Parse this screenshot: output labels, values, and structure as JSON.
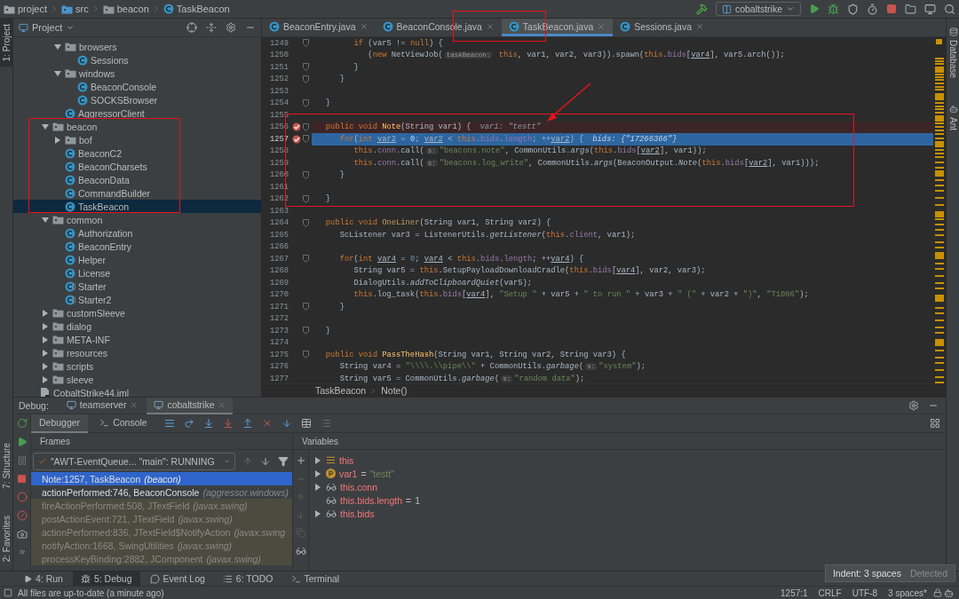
{
  "breadcrumb": [
    {
      "label": "project",
      "kind": "module"
    },
    {
      "label": "src",
      "kind": "source"
    },
    {
      "label": "beacon",
      "kind": "package"
    },
    {
      "label": "TaskBeacon",
      "kind": "class"
    }
  ],
  "run_config": {
    "label": "cobaltstrike"
  },
  "left_strip": {
    "top": [
      {
        "label": "1: Project",
        "selected": true
      }
    ],
    "bottom": [
      {
        "label": "7: Structure",
        "selected": false
      },
      {
        "label": "2: Favorites",
        "selected": false
      }
    ]
  },
  "right_strip": [
    {
      "label": "Database"
    },
    {
      "label": "Ant"
    }
  ],
  "project_panel": {
    "title": "Project",
    "tree": [
      {
        "children": [
          {
            "children": [
              {
                "label": "browsers",
                "kind": "folder",
                "expanded": true,
                "selected": false,
                "children": [
                  {
                    "label": "Sessions",
                    "kind": "class",
                    "selected": false
                  }
                ]
              },
              {
                "label": "windows",
                "kind": "folder",
                "expanded": true,
                "selected": false,
                "children": [
                  {
                    "label": "BeaconConsole",
                    "kind": "class",
                    "selected": false
                  },
                  {
                    "label": "SOCKSBrowser",
                    "kind": "class",
                    "selected": false
                  }
                ]
              },
              {
                "label": "AggressorClient",
                "kind": "class",
                "selected": false
              }
            ]
          },
          {
            "label": "beacon",
            "kind": "folder",
            "expanded": true,
            "selected": false,
            "children": [
              {
                "label": "bof",
                "kind": "folder",
                "expanded": false,
                "selected": false
              },
              {
                "label": "BeaconC2",
                "kind": "class",
                "selected": false
              },
              {
                "label": "BeaconCharsets",
                "kind": "class",
                "selected": false
              },
              {
                "label": "BeaconData",
                "kind": "class",
                "selected": false
              },
              {
                "label": "CommandBuilder",
                "kind": "class",
                "selected": false
              },
              {
                "label": "TaskBeacon",
                "kind": "class",
                "selected": true
              }
            ]
          },
          {
            "label": "common",
            "kind": "folder",
            "expanded": true,
            "selected": false,
            "children": [
              {
                "label": "Authorization",
                "kind": "class",
                "selected": false
              },
              {
                "label": "BeaconEntry",
                "kind": "class",
                "selected": false
              },
              {
                "label": "Helper",
                "kind": "class",
                "selected": false
              },
              {
                "label": "License",
                "kind": "class",
                "selected": false
              },
              {
                "label": "Starter",
                "kind": "runnable",
                "selected": false
              },
              {
                "label": "Starter2",
                "kind": "runnable",
                "selected": false
              }
            ]
          },
          {
            "label": "customSleeve",
            "kind": "folder",
            "expanded": false,
            "selected": false
          },
          {
            "label": "dialog",
            "kind": "folder",
            "expanded": false,
            "selected": false
          },
          {
            "label": "META-INF",
            "kind": "folder",
            "expanded": false,
            "selected": false
          },
          {
            "label": "resources",
            "kind": "folder",
            "expanded": false,
            "selected": false
          },
          {
            "label": "scripts",
            "kind": "folder",
            "expanded": false,
            "selected": false
          },
          {
            "label": "sleeve",
            "kind": "folder",
            "expanded": false,
            "selected": false
          }
        ]
      },
      {
        "label": "CobaltStrike44.iml",
        "kind": "file",
        "selected": false
      }
    ]
  },
  "editor": {
    "tabs": [
      {
        "label": "BeaconEntry.java",
        "selected": false
      },
      {
        "label": "BeaconConsole.java",
        "selected": false
      },
      {
        "label": "TaskBeacon.java",
        "selected": true
      },
      {
        "label": "Sessions.java",
        "selected": false
      }
    ],
    "lines": [
      {
        "number": "1249",
        "fold": true,
        "breakpoint": false,
        "current": false,
        "tokens": [
          {
            "kind": "keyword",
            "text": "         if"
          },
          {
            "kind": "plain",
            "text": " (var5 != "
          },
          {
            "kind": "keyword",
            "text": "null"
          },
          {
            "kind": "plain",
            "text": ") {"
          }
        ]
      },
      {
        "number": "1250",
        "fold": false,
        "breakpoint": false,
        "current": false,
        "tokens": [
          {
            "kind": "plain",
            "text": "            ("
          },
          {
            "kind": "keyword",
            "text": "new"
          },
          {
            "kind": "plain",
            "text": " NetViewJob("
          },
          {
            "kind": "hint",
            "text": "taskBeacon:"
          },
          {
            "kind": "keyword",
            "text": " this"
          },
          {
            "kind": "plain",
            "text": ", var1, var2, var3)).spawn("
          },
          {
            "kind": "keyword",
            "text": "this"
          },
          {
            "kind": "plain",
            "text": "."
          },
          {
            "kind": "field",
            "text": "bids"
          },
          {
            "kind": "plain",
            "text": "["
          },
          {
            "kind": "local",
            "text": "var4"
          },
          {
            "kind": "plain",
            "text": "], var5.arch());"
          }
        ]
      },
      {
        "number": "1251",
        "fold": true,
        "breakpoint": false,
        "current": false,
        "tokens": [
          {
            "kind": "plain",
            "text": "         }"
          }
        ]
      },
      {
        "number": "1252",
        "fold": true,
        "breakpoint": false,
        "current": false,
        "tokens": [
          {
            "kind": "plain",
            "text": "      }"
          }
        ]
      },
      {
        "number": "1253",
        "fold": false,
        "breakpoint": false,
        "current": false
      },
      {
        "number": "1254",
        "fold": true,
        "breakpoint": false,
        "current": false,
        "tokens": [
          {
            "kind": "plain",
            "text": "   }"
          }
        ]
      },
      {
        "number": "1255",
        "fold": false,
        "breakpoint": false,
        "current": false
      },
      {
        "number": "1256",
        "fold": true,
        "breakpoint": true,
        "current": false,
        "tokens": [
          {
            "kind": "keyword",
            "text": "   public void "
          },
          {
            "kind": "method",
            "text": "Note"
          },
          {
            "kind": "plain",
            "text": "(String var1) {"
          },
          {
            "kind": "value",
            "text": "var1: \"testt\""
          }
        ]
      },
      {
        "number": "1257",
        "fold": true,
        "breakpoint": true,
        "current": true,
        "tokens": [
          {
            "kind": "keyword",
            "text": "      for"
          },
          {
            "kind": "plain",
            "text": "("
          },
          {
            "kind": "keyword",
            "text": "int "
          },
          {
            "kind": "local",
            "text": "var2"
          },
          {
            "kind": "plain",
            "text": " = "
          },
          {
            "kind": "number",
            "text": "0"
          },
          {
            "kind": "plain",
            "text": "; "
          },
          {
            "kind": "local",
            "text": "var2"
          },
          {
            "kind": "plain",
            "text": " < "
          },
          {
            "kind": "keyword",
            "text": "this"
          },
          {
            "kind": "plain",
            "text": "."
          },
          {
            "kind": "field",
            "text": "bids"
          },
          {
            "kind": "plain",
            "text": "."
          },
          {
            "kind": "field",
            "text": "length"
          },
          {
            "kind": "plain",
            "text": "; ++"
          },
          {
            "kind": "local",
            "text": "var2"
          },
          {
            "kind": "plain",
            "text": ") {"
          },
          {
            "kind": "value",
            "text": "bids: {\"17266366\"}"
          }
        ]
      },
      {
        "number": "1258",
        "fold": false,
        "breakpoint": false,
        "current": false,
        "tokens": [
          {
            "kind": "keyword",
            "text": "         this"
          },
          {
            "kind": "plain",
            "text": "."
          },
          {
            "kind": "field",
            "text": "conn"
          },
          {
            "kind": "plain",
            "text": ".call("
          },
          {
            "kind": "hint",
            "text": "s:"
          },
          {
            "kind": "string",
            "text": "\"beacons.note\""
          },
          {
            "kind": "plain",
            "text": ", CommonUtils."
          },
          {
            "kind": "static",
            "text": "args"
          },
          {
            "kind": "plain",
            "text": "("
          },
          {
            "kind": "keyword",
            "text": "this"
          },
          {
            "kind": "plain",
            "text": "."
          },
          {
            "kind": "field",
            "text": "bids"
          },
          {
            "kind": "plain",
            "text": "["
          },
          {
            "kind": "local",
            "text": "var2"
          },
          {
            "kind": "plain",
            "text": "], var1));"
          }
        ]
      },
      {
        "number": "1259",
        "fold": false,
        "breakpoint": false,
        "current": false,
        "tokens": [
          {
            "kind": "keyword",
            "text": "         this"
          },
          {
            "kind": "plain",
            "text": "."
          },
          {
            "kind": "field",
            "text": "conn"
          },
          {
            "kind": "plain",
            "text": ".call("
          },
          {
            "kind": "hint",
            "text": "s:"
          },
          {
            "kind": "string",
            "text": "\"beacons.log_write\""
          },
          {
            "kind": "plain",
            "text": ", CommonUtils."
          },
          {
            "kind": "static",
            "text": "args"
          },
          {
            "kind": "plain",
            "text": "(BeaconOutput."
          },
          {
            "kind": "static",
            "text": "Note"
          },
          {
            "kind": "plain",
            "text": "("
          },
          {
            "kind": "keyword",
            "text": "this"
          },
          {
            "kind": "plain",
            "text": "."
          },
          {
            "kind": "field",
            "text": "bids"
          },
          {
            "kind": "plain",
            "text": "["
          },
          {
            "kind": "local",
            "text": "var2"
          },
          {
            "kind": "plain",
            "text": "], var1)));"
          }
        ]
      },
      {
        "number": "1260",
        "fold": true,
        "breakpoint": false,
        "current": false,
        "tokens": [
          {
            "kind": "plain",
            "text": "      }"
          }
        ]
      },
      {
        "number": "1261",
        "fold": false,
        "breakpoint": false,
        "current": false
      },
      {
        "number": "1262",
        "fold": true,
        "breakpoint": false,
        "current": false,
        "tokens": [
          {
            "kind": "plain",
            "text": "   }"
          }
        ]
      },
      {
        "number": "1263",
        "fold": false,
        "breakpoint": false,
        "current": false
      },
      {
        "number": "1264",
        "fold": true,
        "breakpoint": false,
        "current": false,
        "tokens": [
          {
            "kind": "keyword",
            "text": "   public void "
          },
          {
            "kind": "unused",
            "text": "OneLiner"
          },
          {
            "kind": "plain",
            "text": "(String var1, String var2) {"
          }
        ]
      },
      {
        "number": "1265",
        "fold": false,
        "breakpoint": false,
        "current": false,
        "tokens": [
          {
            "kind": "plain",
            "text": "      ScListener var3 = ListenerUtils."
          },
          {
            "kind": "static",
            "text": "getListener"
          },
          {
            "kind": "plain",
            "text": "("
          },
          {
            "kind": "keyword",
            "text": "this"
          },
          {
            "kind": "plain",
            "text": "."
          },
          {
            "kind": "field",
            "text": "client"
          },
          {
            "kind": "plain",
            "text": ", var1);"
          }
        ]
      },
      {
        "number": "1266",
        "fold": false,
        "breakpoint": false,
        "current": false
      },
      {
        "number": "1267",
        "fold": true,
        "breakpoint": false,
        "current": false,
        "tokens": [
          {
            "kind": "keyword",
            "text": "      for"
          },
          {
            "kind": "plain",
            "text": "("
          },
          {
            "kind": "keyword",
            "text": "int "
          },
          {
            "kind": "local",
            "text": "var4"
          },
          {
            "kind": "plain",
            "text": " = "
          },
          {
            "kind": "number",
            "text": "0"
          },
          {
            "kind": "plain",
            "text": "; "
          },
          {
            "kind": "local",
            "text": "var4"
          },
          {
            "kind": "plain",
            "text": " < "
          },
          {
            "kind": "keyword",
            "text": "this"
          },
          {
            "kind": "plain",
            "text": "."
          },
          {
            "kind": "field",
            "text": "bids"
          },
          {
            "kind": "plain",
            "text": "."
          },
          {
            "kind": "field",
            "text": "length"
          },
          {
            "kind": "plain",
            "text": "; ++"
          },
          {
            "kind": "local",
            "text": "var4"
          },
          {
            "kind": "plain",
            "text": ") {"
          }
        ]
      },
      {
        "number": "1268",
        "fold": false,
        "breakpoint": false,
        "current": false,
        "tokens": [
          {
            "kind": "plain",
            "text": "         String var5 = "
          },
          {
            "kind": "keyword",
            "text": "this"
          },
          {
            "kind": "plain",
            "text": ".SetupPayloadDownloadCradle("
          },
          {
            "kind": "keyword",
            "text": "this"
          },
          {
            "kind": "plain",
            "text": "."
          },
          {
            "kind": "field",
            "text": "bids"
          },
          {
            "kind": "plain",
            "text": "["
          },
          {
            "kind": "local",
            "text": "var4"
          },
          {
            "kind": "plain",
            "text": "], var2, var3);"
          }
        ]
      },
      {
        "number": "1269",
        "fold": false,
        "breakpoint": false,
        "current": false,
        "tokens": [
          {
            "kind": "plain",
            "text": "         DialogUtils."
          },
          {
            "kind": "static",
            "text": "addToClipboardQuiet"
          },
          {
            "kind": "plain",
            "text": "(var5);"
          }
        ]
      },
      {
        "number": "1270",
        "fold": false,
        "breakpoint": false,
        "current": false,
        "tokens": [
          {
            "kind": "keyword",
            "text": "         this"
          },
          {
            "kind": "plain",
            "text": ".log_task("
          },
          {
            "kind": "keyword",
            "text": "this"
          },
          {
            "kind": "plain",
            "text": "."
          },
          {
            "kind": "field",
            "text": "bids"
          },
          {
            "kind": "plain",
            "text": "["
          },
          {
            "kind": "local",
            "text": "var4"
          },
          {
            "kind": "plain",
            "text": "], "
          },
          {
            "kind": "string",
            "text": "\"Setup \""
          },
          {
            "kind": "plain",
            "text": " + var5 + "
          },
          {
            "kind": "string",
            "text": "\" to run \""
          },
          {
            "kind": "plain",
            "text": " + var3 + "
          },
          {
            "kind": "string",
            "text": "\" (\""
          },
          {
            "kind": "plain",
            "text": " + var2 + "
          },
          {
            "kind": "string",
            "text": "\")\""
          },
          {
            "kind": "plain",
            "text": ", "
          },
          {
            "kind": "string",
            "text": "\"T1086\""
          },
          {
            "kind": "plain",
            "text": ");"
          }
        ]
      },
      {
        "number": "1271",
        "fold": true,
        "breakpoint": false,
        "current": false,
        "tokens": [
          {
            "kind": "plain",
            "text": "      }"
          }
        ]
      },
      {
        "number": "1272",
        "fold": false,
        "breakpoint": false,
        "current": false
      },
      {
        "number": "1273",
        "fold": true,
        "breakpoint": false,
        "current": false,
        "tokens": [
          {
            "kind": "plain",
            "text": "   }"
          }
        ]
      },
      {
        "number": "1274",
        "fold": false,
        "breakpoint": false,
        "current": false
      },
      {
        "number": "1275",
        "fold": true,
        "breakpoint": false,
        "current": false,
        "tokens": [
          {
            "kind": "keyword",
            "text": "   public void "
          },
          {
            "kind": "method",
            "text": "PassTheHash"
          },
          {
            "kind": "plain",
            "text": "(String var1, String var2, String var3) {"
          }
        ]
      },
      {
        "number": "1276",
        "fold": false,
        "breakpoint": false,
        "current": false,
        "tokens": [
          {
            "kind": "plain",
            "text": "      String var4 = "
          },
          {
            "kind": "string",
            "text": "\"\\\\\\\\.\\\\pipe\\\\\""
          },
          {
            "kind": "plain",
            "text": " + CommonUtils."
          },
          {
            "kind": "static",
            "text": "garbage"
          },
          {
            "kind": "plain",
            "text": "("
          },
          {
            "kind": "hint",
            "text": "s:"
          },
          {
            "kind": "string",
            "text": "\"system\""
          },
          {
            "kind": "plain",
            "text": ");"
          }
        ]
      },
      {
        "number": "1277",
        "fold": false,
        "breakpoint": false,
        "current": false,
        "tokens": [
          {
            "kind": "plain",
            "text": "      String var5 = CommonUtils."
          },
          {
            "kind": "static",
            "text": "garbage"
          },
          {
            "kind": "plain",
            "text": "("
          },
          {
            "kind": "hint",
            "text": "s:"
          },
          {
            "kind": "string",
            "text": "\"random data\""
          },
          {
            "kind": "plain",
            "text": ");"
          }
        ]
      }
    ],
    "breadcrumb": [
      "TaskBeacon",
      "Note()"
    ]
  },
  "debug": {
    "title": "Debug:",
    "sessions": [
      {
        "label": "teamserver",
        "selected": false
      },
      {
        "label": "cobaltstrike",
        "selected": true
      }
    ],
    "tabs": [
      {
        "label": "Debugger",
        "selected": true
      },
      {
        "label": "Console",
        "selected": false
      }
    ],
    "frames": {
      "title": "Frames",
      "thread": "\"AWT-EventQueue... \"main\": RUNNING",
      "items": [
        {
          "method": "Note:1257, TaskBeacon",
          "package": "(beacon)",
          "selected": true,
          "library": false
        },
        {
          "method": "actionPerformed:746, BeaconConsole",
          "package": "(aggressor.windows)",
          "selected": false,
          "library": false
        },
        {
          "method": "fireActionPerformed:508, JTextField",
          "package": "(javax.swing)",
          "selected": false,
          "library": true
        },
        {
          "method": "postActionEvent:721, JTextField",
          "package": "(javax.swing)",
          "selected": false,
          "library": true
        },
        {
          "method": "actionPerformed:836, JTextField$NotifyAction",
          "package": "(javax.swing",
          "selected": false,
          "library": true
        },
        {
          "method": "notifyAction:1668, SwingUtilities",
          "package": "(javax.swing)",
          "selected": false,
          "library": true
        },
        {
          "method": "processKeyBinding:2882, JComponent",
          "package": "(javax.swing)",
          "selected": false,
          "library": true
        }
      ]
    },
    "variables": {
      "title": "Variables",
      "items": [
        {
          "name": "this",
          "kind": "object",
          "expandable": true
        },
        {
          "name": "var1",
          "separator": "=",
          "value": "\"testt\"",
          "kind": "param",
          "expandable": true
        },
        {
          "name": "this.conn",
          "kind": "watch",
          "expandable": true
        },
        {
          "name": "this.bids.length",
          "separator": "=",
          "value": "1",
          "kind": "watch",
          "expandable": false
        },
        {
          "name": "this.bids",
          "kind": "watch",
          "expandable": true
        }
      ]
    }
  },
  "tool_tabs": [
    {
      "label": "4: Run",
      "kind": "run",
      "selected": false
    },
    {
      "label": "5: Debug",
      "kind": "debug",
      "selected": true
    },
    {
      "label": "Event Log",
      "kind": "log",
      "selected": false
    },
    {
      "label": "6: TODO",
      "kind": "todo",
      "selected": false
    },
    {
      "label": "Terminal",
      "kind": "terminal",
      "selected": false
    }
  ],
  "status": {
    "message": "All files are up-to-date (a minute ago)",
    "items": [
      "1257:1",
      "CRLF",
      "UTF-8",
      "3 spaces*"
    ]
  },
  "popup": {
    "text": "Indent: 3 spaces",
    "note": "Detected"
  }
}
